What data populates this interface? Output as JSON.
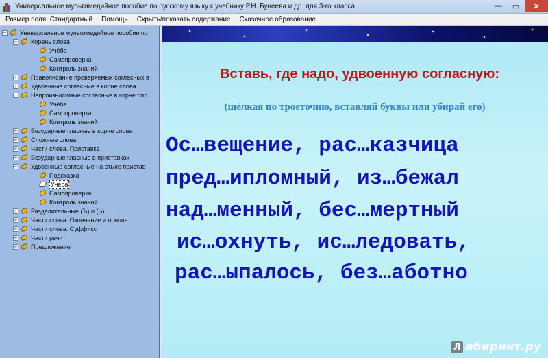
{
  "window": {
    "title": "Универсальное мультимедийное пособие по русскому языку к учебнику Р.Н. Бунеева и др. для 3-го класса",
    "controls": {
      "minimize": "—",
      "maximize": "▭",
      "close": "✕"
    }
  },
  "menu": {
    "items": [
      "Размер поля: Стандартный",
      "Помощь",
      "Скрыть/показать содержание",
      "Сказочное образование"
    ]
  },
  "tree": {
    "nodes": [
      {
        "label": "Универсальное мультимедийное пособие по",
        "level": 0,
        "expander": "−",
        "icon": "book-icon"
      },
      {
        "label": "Корень слова",
        "level": 1,
        "expander": "−",
        "icon": "book-icon"
      },
      {
        "label": "Учёба",
        "level": 2,
        "expander": "",
        "icon": "leaf-icon"
      },
      {
        "label": "Самопроверка",
        "level": 2,
        "expander": "",
        "icon": "leaf-icon"
      },
      {
        "label": "Контроль знаний",
        "level": 2,
        "expander": "",
        "icon": "leaf-icon"
      },
      {
        "label": "Правописание проверяемых согласных в",
        "level": 1,
        "expander": "+",
        "icon": "book-icon"
      },
      {
        "label": "Удвоенные согласные в корне слова",
        "level": 1,
        "expander": "+",
        "icon": "book-icon"
      },
      {
        "label": "Непроизносимые согласные в корне сло",
        "level": 1,
        "expander": "−",
        "icon": "book-icon"
      },
      {
        "label": "Учёба",
        "level": 2,
        "expander": "",
        "icon": "leaf-icon"
      },
      {
        "label": "Самопроверка",
        "level": 2,
        "expander": "",
        "icon": "leaf-icon"
      },
      {
        "label": "Контроль знаний",
        "level": 2,
        "expander": "",
        "icon": "leaf-icon"
      },
      {
        "label": "Безударные гласные в корне слова",
        "level": 1,
        "expander": "+",
        "icon": "book-icon"
      },
      {
        "label": "Сложные слова",
        "level": 1,
        "expander": "+",
        "icon": "book-icon"
      },
      {
        "label": "Части слова. Приставка",
        "level": 1,
        "expander": "+",
        "icon": "book-icon"
      },
      {
        "label": "Безударные гласные в приставках",
        "level": 1,
        "expander": "+",
        "icon": "book-icon"
      },
      {
        "label": "Удвоенные согласные на стыке пристав",
        "level": 1,
        "expander": "−",
        "icon": "book-icon"
      },
      {
        "label": "Подсказка",
        "level": 2,
        "expander": "",
        "icon": "leaf-icon"
      },
      {
        "label": "Учёба",
        "level": 2,
        "expander": "",
        "icon": "open-leaf-icon",
        "selected": true
      },
      {
        "label": "Самопроверка",
        "level": 2,
        "expander": "",
        "icon": "leaf-icon"
      },
      {
        "label": "Контроль знаний",
        "level": 2,
        "expander": "",
        "icon": "leaf-icon"
      },
      {
        "label": "Разделительные (Ъ) и (Ь)",
        "level": 1,
        "expander": "+",
        "icon": "book-icon"
      },
      {
        "label": "Части слова. Окончание и основа",
        "level": 1,
        "expander": "+",
        "icon": "book-icon"
      },
      {
        "label": "Части слова. Суффикс",
        "level": 1,
        "expander": "+",
        "icon": "book-icon"
      },
      {
        "label": "Части речи",
        "level": 1,
        "expander": "+",
        "icon": "book-icon"
      },
      {
        "label": "Предложение",
        "level": 1,
        "expander": "+",
        "icon": "book-icon"
      }
    ]
  },
  "lesson": {
    "heading": "Вставь, где надо, удвоенную согласную:",
    "instruction": "(щёлкая по троеточию, вставляй буквы или убирай его)",
    "lines": [
      "Ос…вещение, рас…казчица",
      "пред…ипломный, из…бежал",
      "над…менный, бес…мертный",
      "ис…охнуть, ис…ледовать,",
      "рас…ыпалось, без…аботно"
    ],
    "colors": {
      "heading": "#c0161a",
      "instruction": "#2f7fdc",
      "words": "#1414b8"
    }
  },
  "watermark": {
    "badge": "Л",
    "text": "абиринт.ру"
  }
}
